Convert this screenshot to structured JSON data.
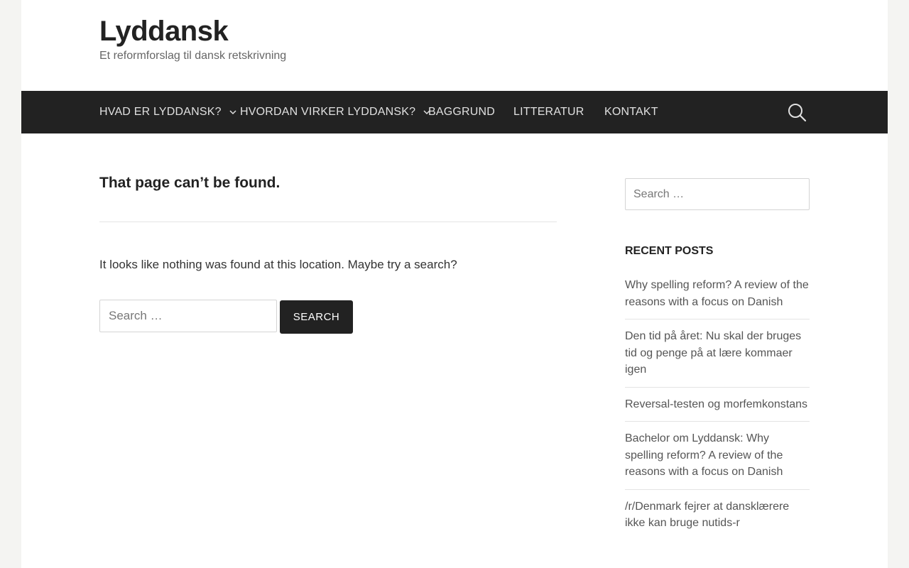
{
  "site": {
    "title": "Lyddansk",
    "tagline": "Et reformforslag til dansk retskrivning"
  },
  "nav": {
    "items": [
      {
        "label": "HVAD ER LYDDANSK?",
        "has_dropdown": true
      },
      {
        "label": "HVORDAN VIRKER LYDDANSK?",
        "has_dropdown": true
      },
      {
        "label": "BAGGRUND",
        "has_dropdown": false
      },
      {
        "label": "LITTERATUR",
        "has_dropdown": false
      },
      {
        "label": "KONTAKT",
        "has_dropdown": false
      }
    ],
    "search_icon": "search-icon"
  },
  "main": {
    "heading": "That page can’t be found.",
    "message": "It looks like nothing was found at this location. Maybe try a search?",
    "search": {
      "placeholder": "Search …",
      "button_label": "SEARCH"
    }
  },
  "sidebar": {
    "search_placeholder": "Search …",
    "recent_posts_heading": "RECENT POSTS",
    "recent_posts": [
      "Why spelling reform? A review of the reasons with a focus on Danish",
      "Den tid på året: Nu skal der bruges tid og penge på at lære kommaer igen",
      "Reversal-testen og morfemkonstans",
      "Bachelor om Lyddansk: Why spelling reform? A review of the reasons with a focus on Danish",
      "/r/Denmark fejrer at dansklærere ikke kan bruge nutids-r"
    ]
  },
  "colors": {
    "page_bg": "#f4f4f2",
    "content_bg": "#ffffff",
    "navbar_bg": "#222222",
    "nav_text": "#e0e0e0",
    "button_bg": "#222222"
  }
}
